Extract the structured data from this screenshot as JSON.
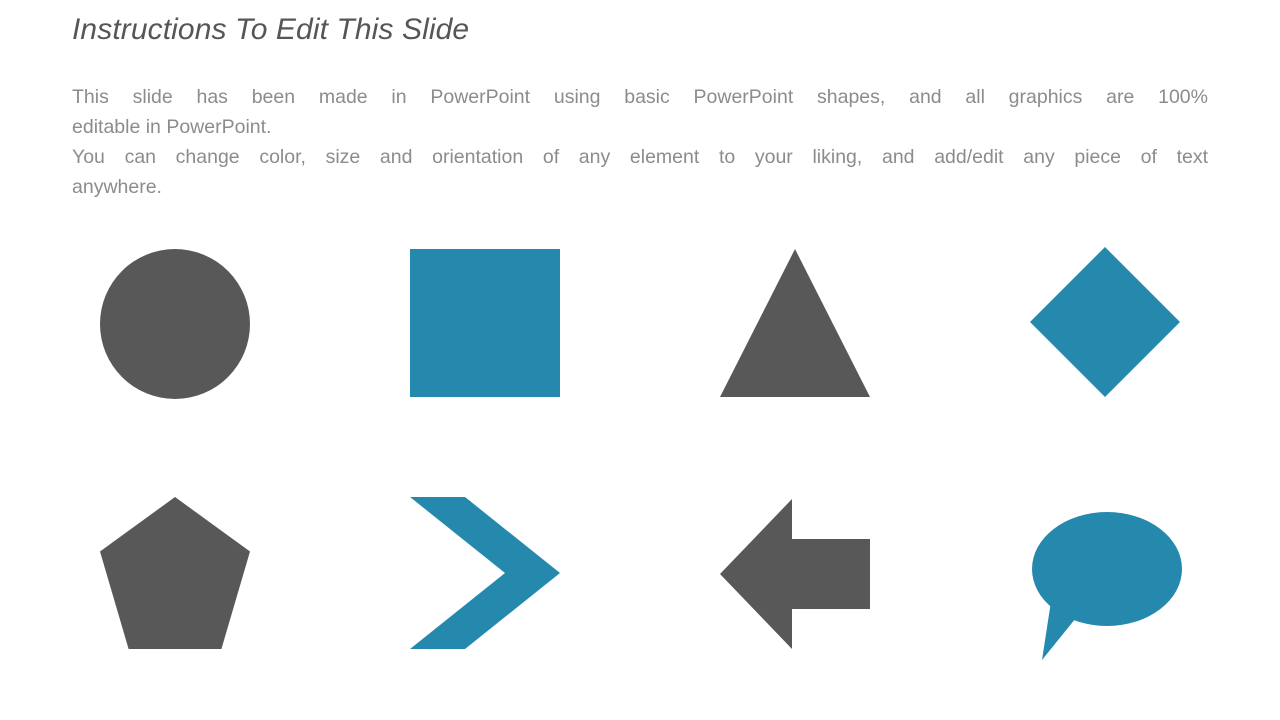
{
  "slide": {
    "title": "Instructions To Edit This Slide",
    "body": {
      "paragraph1_line1": "This slide has been made in PowerPoint using basic PowerPoint shapes, and all graphics are 100%",
      "paragraph1_line2": "editable in PowerPoint.",
      "paragraph2_line1": "You can change color, size and orientation of any element to your liking, and add/edit any piece of text",
      "paragraph2_line2": "anywhere."
    }
  },
  "colors": {
    "title_gray": "#565656",
    "body_gray": "#8c8c8c",
    "shape_gray": "#585858",
    "shape_blue": "#2589AD",
    "background": "#ffffff"
  },
  "shapes": {
    "row1": [
      {
        "name": "circle",
        "label": "Circle",
        "color": "#585858"
      },
      {
        "name": "square",
        "label": "Square",
        "color": "#2589AD"
      },
      {
        "name": "triangle",
        "label": "Triangle",
        "color": "#585858"
      },
      {
        "name": "diamond",
        "label": "Diamond",
        "color": "#2589AD"
      }
    ],
    "row2": [
      {
        "name": "pentagon",
        "label": "Pentagon",
        "color": "#585858"
      },
      {
        "name": "chevron",
        "label": "Chevron Arrow",
        "color": "#2589AD"
      },
      {
        "name": "arrow-left",
        "label": "Left Arrow",
        "color": "#585858"
      },
      {
        "name": "speech",
        "label": "Speech Bubble",
        "color": "#2589AD"
      }
    ]
  }
}
